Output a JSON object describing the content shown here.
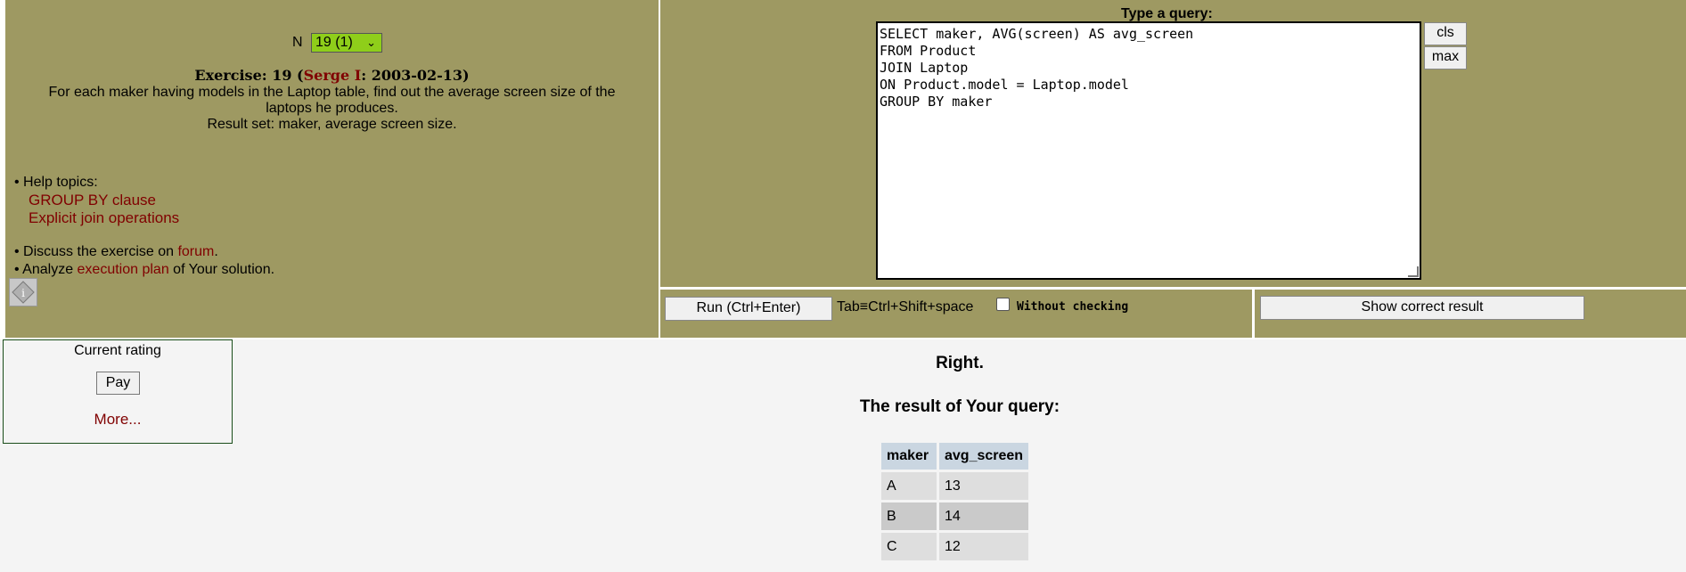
{
  "left": {
    "n_label": "N",
    "n_select_value": "19 (1)",
    "exercise_prefix": "Exercise: 19 (",
    "author": "Serge I",
    "exercise_date": ": 2003-02-13)",
    "task_line1": "For each maker having models in the Laptop table, find out the average screen size of the",
    "task_line2": "laptops he produces.",
    "result_set": "Result set: maker, average screen size.",
    "help_title": "• Help topics:",
    "help_links": [
      "GROUP BY clause",
      "Explicit join operations"
    ],
    "discuss_prefix": "• Discuss the exercise on ",
    "discuss_link": "forum",
    "discuss_suffix": ".",
    "analyze_prefix": "• Analyze ",
    "analyze_link": "execution plan",
    "analyze_suffix": " of Your solution."
  },
  "query": {
    "label": "Type a query:",
    "sql": "SELECT maker, AVG(screen) AS avg_screen\nFROM Product\nJOIN Laptop\nON Product.model = Laptop.model\nGROUP BY maker",
    "cls_label": "cls",
    "max_label": "max"
  },
  "controls": {
    "run_label": "Run (Ctrl+Enter)",
    "tab_hint": "Tab≡Ctrl+Shift+space",
    "without_checking": "Without checking",
    "show_correct": "Show correct result"
  },
  "rating": {
    "title": "Current rating",
    "pay_label": "Pay",
    "more_label": "More..."
  },
  "result": {
    "verdict": "Right.",
    "heading": "The result of Your query:",
    "columns": [
      "maker",
      "avg_screen"
    ],
    "rows": [
      [
        "A",
        "13"
      ],
      [
        "B",
        "14"
      ],
      [
        "C",
        "12"
      ]
    ]
  }
}
